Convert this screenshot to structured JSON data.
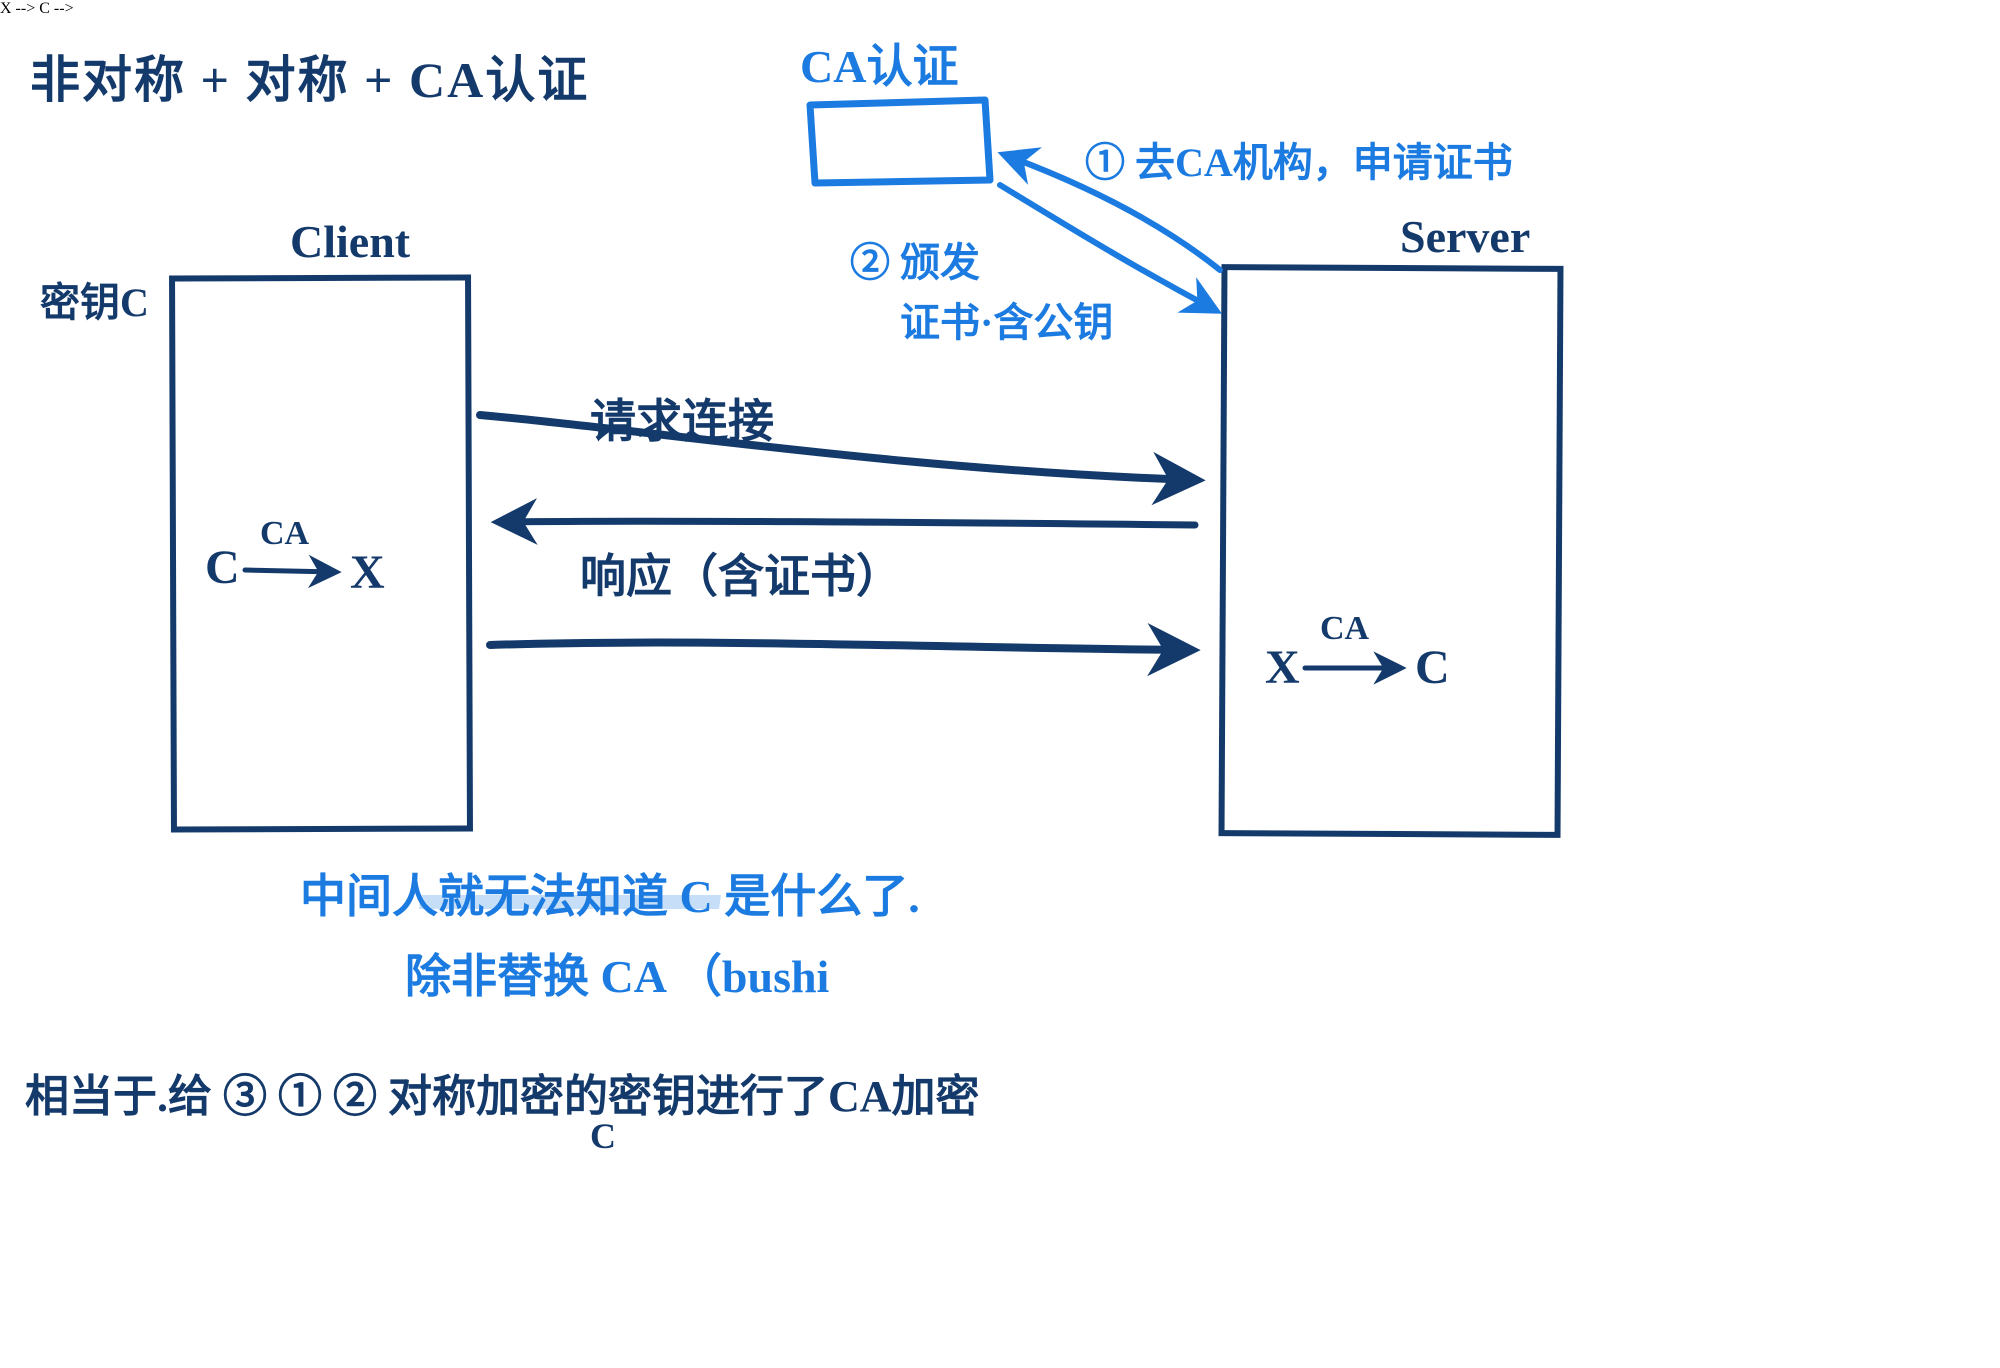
{
  "colors": {
    "navy": "#143a6b",
    "blue": "#1c7be0"
  },
  "title": "非对称 + 对称 + CA认证",
  "ca": {
    "label": "CA认证",
    "step1": "① 去CA机构，申请证书",
    "step2a": "② 颁发",
    "step2b": "证书·含公钥"
  },
  "client": {
    "label": "Client",
    "keyLabel": "密钥C",
    "formula_left": "C",
    "formula_arrowLabel": "CA",
    "formula_right": "X"
  },
  "server": {
    "label": "Server",
    "formula_left": "X",
    "formula_arrowLabel": "CA",
    "formula_right": "C"
  },
  "messages": {
    "m1": "请求连接",
    "m2": "响应（含证书）",
    "m3": ""
  },
  "footer": {
    "line1": "中间人就无法知道 C 是什么了.",
    "line2": "除非替换 CA （bushi",
    "line3": "相当于.给 ③ ① ② 对称加密的密钥进行了CA加密",
    "sub": "C"
  }
}
